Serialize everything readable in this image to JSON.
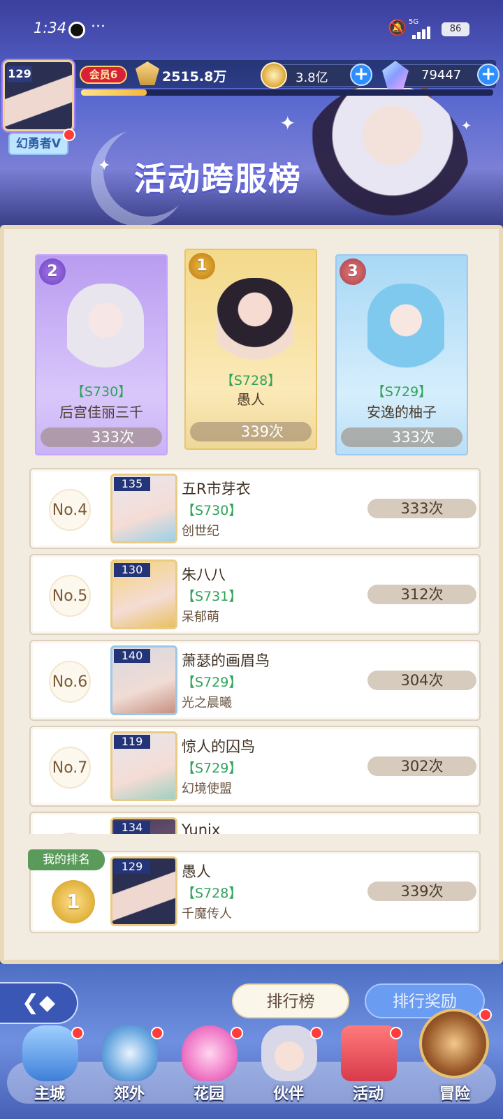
{
  "status_bar": {
    "time": "1:34",
    "more": "···",
    "network": "5G",
    "battery": "86"
  },
  "player": {
    "level": "129",
    "name": "幻勇者V",
    "vip": "会员6",
    "power": "2515.8万",
    "exp_fraction": 0.16
  },
  "currency": {
    "coins": "3.8亿",
    "gems": "79447"
  },
  "header": {
    "title": "活动跨服榜"
  },
  "podium": [
    {
      "rank": "2",
      "server": "【S730】",
      "name": "后宫佳丽三千",
      "count": "333次"
    },
    {
      "rank": "1",
      "server": "【S728】",
      "name": "愚人",
      "count": "339次"
    },
    {
      "rank": "3",
      "server": "【S729】",
      "name": "安逸的柚子",
      "count": "333次"
    }
  ],
  "rows": [
    {
      "no": "No.4",
      "level": "135",
      "name": "五R市芽衣",
      "server": "【S730】",
      "guild": "创世纪",
      "count": "333次"
    },
    {
      "no": "No.5",
      "level": "130",
      "name": "朱八八",
      "server": "【S731】",
      "guild": "呆郁萌",
      "count": "312次"
    },
    {
      "no": "No.6",
      "level": "140",
      "name": "萧瑟的画眉鸟",
      "server": "【S729】",
      "guild": "光之晨曦",
      "count": "304次"
    },
    {
      "no": "No.7",
      "level": "119",
      "name": "惊人的囚鸟",
      "server": "【S729】",
      "guild": "幻境使盟",
      "count": "302次"
    },
    {
      "no": "",
      "level": "134",
      "name": "Yunix",
      "server": "",
      "guild": "",
      "count": ""
    }
  ],
  "my_rank": {
    "tag": "我的排名",
    "rank": "1",
    "level": "129",
    "name": "愚人",
    "server": "【S728】",
    "guild": "千魔传人",
    "count": "339次"
  },
  "tabs": {
    "ranking": "排行榜",
    "reward": "排行奖励"
  },
  "nav": [
    {
      "label": "主城",
      "icon": "castle-icon"
    },
    {
      "label": "郊外",
      "icon": "portal-icon"
    },
    {
      "label": "花园",
      "icon": "heart-icon"
    },
    {
      "label": "伙伴",
      "icon": "partner-icon"
    },
    {
      "label": "活动",
      "icon": "gift-icon"
    },
    {
      "label": "冒险",
      "icon": "compass-icon"
    }
  ]
}
